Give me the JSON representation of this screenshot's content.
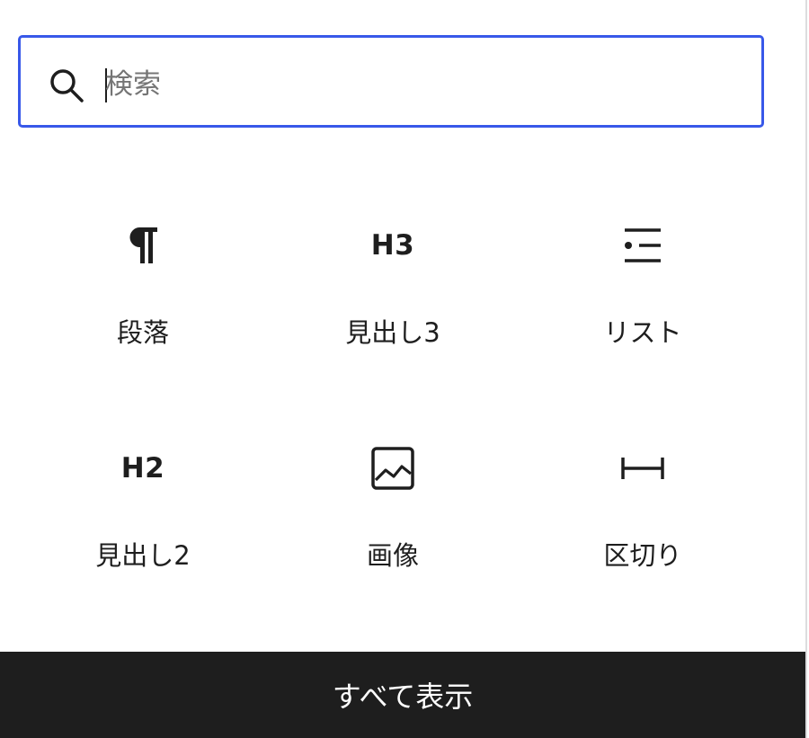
{
  "search": {
    "placeholder": "検索",
    "icon": "search-icon"
  },
  "blocks": [
    {
      "label": "段落",
      "icon": "paragraph-icon"
    },
    {
      "label": "見出し3",
      "icon": "heading-3-icon",
      "glyph": "H3"
    },
    {
      "label": "リスト",
      "icon": "list-icon"
    },
    {
      "label": "見出し2",
      "icon": "heading-2-icon",
      "glyph": "H2"
    },
    {
      "label": "画像",
      "icon": "image-icon"
    },
    {
      "label": "区切り",
      "icon": "separator-icon"
    }
  ],
  "footer": {
    "browse_all_label": "すべて表示"
  },
  "colors": {
    "accent": "#3858e9",
    "text": "#1e1e1e",
    "footer_bg": "#1e1e1e",
    "footer_text": "#ffffff"
  }
}
